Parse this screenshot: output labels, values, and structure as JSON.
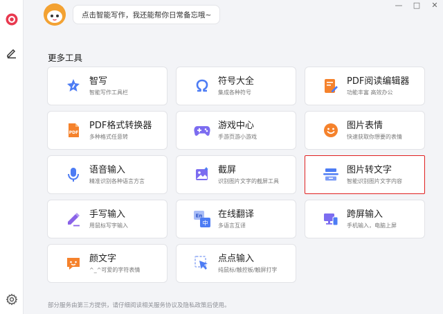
{
  "assistant": {
    "greeting": "点击智能写作，我还能帮你日常备忘哦~"
  },
  "window_controls": {
    "minimize_glyph": "—",
    "restore_glyph": "□",
    "close_glyph": "✕"
  },
  "section_title": "更多工具",
  "tools": [
    {
      "name": "智写",
      "desc": "智能写作工具栏",
      "icon": "smart-write-icon"
    },
    {
      "name": "符号大全",
      "desc": "集成各种符号",
      "icon": "omega-symbol-icon"
    },
    {
      "name": "PDF阅读编辑器",
      "desc": "功能丰富 高效办公",
      "icon": "pdf-editor-icon"
    },
    {
      "name": "PDF格式转换器",
      "desc": "多种格式任意转",
      "icon": "pdf-converter-icon"
    },
    {
      "name": "游戏中心",
      "desc": "手游页游小游戏",
      "icon": "gamepad-icon"
    },
    {
      "name": "图片表情",
      "desc": "快速获取你想要的表情",
      "icon": "smiley-icon"
    },
    {
      "name": "语音输入",
      "desc": "精准识别各种语言方言",
      "icon": "microphone-icon"
    },
    {
      "name": "截屏",
      "desc": "识别图片文字的截屏工具",
      "icon": "screenshot-icon"
    },
    {
      "name": "图片转文字",
      "desc": "智能识别图片文字内容",
      "icon": "image-to-text-icon"
    },
    {
      "name": "手写输入",
      "desc": "用鼠标写字输入",
      "icon": "pen-icon"
    },
    {
      "name": "在线翻译",
      "desc": "多语言互译",
      "icon": "translate-icon"
    },
    {
      "name": "跨屏输入",
      "desc": "手机输入，电脑上屏",
      "icon": "cross-screen-icon"
    },
    {
      "name": "颜文字",
      "desc": "^_^可爱的字符表情",
      "icon": "kaomoji-icon"
    },
    {
      "name": "点点输入",
      "desc": "纯鼠标/触控板/触屏打字",
      "icon": "cursor-icon"
    }
  ],
  "selected_tool": "图片转文字",
  "footer": "部分服务由第三方提供，请仔细阅读相关服务协议及隐私政策后使用。",
  "colors": {
    "accent_red": "#e01f1f",
    "logo_red": "#e8394f",
    "blue": "#4d7cf4",
    "orange": "#f5822c",
    "purple": "#7c6cf0",
    "background": "#f3f4f7"
  }
}
